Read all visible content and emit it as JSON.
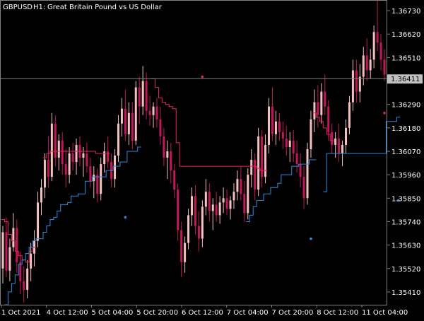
{
  "header": {
    "symbol": "GBPUSD",
    "timeframe": "H1:",
    "description": "Great Britain Pound vs US Dollar"
  },
  "colors": {
    "background": "#000000",
    "frame": "#7f7f7f",
    "text": "#ffffff",
    "candle_bull": "#f5c0c0",
    "candle_bear": "#c2185b",
    "trail_upper": "#e8245a",
    "trail_lower": "#2b8de0",
    "price_line": "#808080",
    "price_label_bg": "#c0c0c0"
  },
  "chart_data": {
    "type": "candlestick",
    "symbol": "GBPUSD",
    "timeframe": "H1",
    "title": "Great Britain Pound vs US Dollar",
    "ylim": [
      1.3535,
      1.3678
    ],
    "y_ticks": [
      "1.36730",
      "1.36620",
      "1.36510",
      "1.36290",
      "1.36180",
      "1.36070",
      "1.35960",
      "1.35850",
      "1.35740",
      "1.35630",
      "1.35520",
      "1.35410"
    ],
    "x_ticks": [
      "1 Oct 2021",
      "4 Oct 12:00",
      "5 Oct 04:00",
      "5 Oct 20:00",
      "6 Oct 12:00",
      "7 Oct 04:00",
      "7 Oct 20:00",
      "8 Oct 12:00",
      "11 Oct 04:00"
    ],
    "current_price": "1.36411",
    "candles": [
      [
        1.3552,
        1.3572,
        1.3545,
        1.3569
      ],
      [
        1.3569,
        1.3576,
        1.3548,
        1.3551
      ],
      [
        1.3551,
        1.3566,
        1.3546,
        1.3562
      ],
      [
        1.3562,
        1.3578,
        1.356,
        1.3571
      ],
      [
        1.3571,
        1.3575,
        1.355,
        1.3555
      ],
      [
        1.3555,
        1.356,
        1.354,
        1.3546
      ],
      [
        1.3546,
        1.3553,
        1.3536,
        1.3542
      ],
      [
        1.3542,
        1.3556,
        1.3538,
        1.3552
      ],
      [
        1.3552,
        1.3564,
        1.3546,
        1.3559
      ],
      [
        1.3559,
        1.357,
        1.3553,
        1.3565
      ],
      [
        1.3565,
        1.3588,
        1.3562,
        1.3583
      ],
      [
        1.3583,
        1.3594,
        1.3577,
        1.359
      ],
      [
        1.359,
        1.3606,
        1.3585,
        1.3603
      ],
      [
        1.3603,
        1.3614,
        1.359,
        1.3595
      ],
      [
        1.3595,
        1.3625,
        1.3593,
        1.362
      ],
      [
        1.362,
        1.3624,
        1.36,
        1.3604
      ],
      [
        1.3604,
        1.3615,
        1.3598,
        1.3612
      ],
      [
        1.3612,
        1.3616,
        1.3596,
        1.3601
      ],
      [
        1.3601,
        1.3608,
        1.359,
        1.3596
      ],
      [
        1.3596,
        1.3609,
        1.3592,
        1.3606
      ],
      [
        1.3606,
        1.3611,
        1.3598,
        1.3602
      ],
      [
        1.3602,
        1.3613,
        1.3596,
        1.361
      ],
      [
        1.361,
        1.3614,
        1.36,
        1.3604
      ],
      [
        1.3604,
        1.3609,
        1.3595,
        1.3606
      ],
      [
        1.3606,
        1.3611,
        1.3597,
        1.36
      ],
      [
        1.36,
        1.3604,
        1.359,
        1.3593
      ],
      [
        1.3593,
        1.36,
        1.3585,
        1.3596
      ],
      [
        1.3596,
        1.3599,
        1.3583,
        1.3587
      ],
      [
        1.3587,
        1.3604,
        1.3584,
        1.3601
      ],
      [
        1.3601,
        1.3611,
        1.3597,
        1.3607
      ],
      [
        1.3607,
        1.3614,
        1.3599,
        1.3602
      ],
      [
        1.3602,
        1.3606,
        1.359,
        1.3594
      ],
      [
        1.3594,
        1.3608,
        1.359,
        1.3605
      ],
      [
        1.3605,
        1.3624,
        1.3602,
        1.362
      ],
      [
        1.362,
        1.3632,
        1.3614,
        1.3627
      ],
      [
        1.3627,
        1.3636,
        1.3612,
        1.3615
      ],
      [
        1.3615,
        1.363,
        1.361,
        1.3625
      ],
      [
        1.3625,
        1.363,
        1.3608,
        1.3612
      ],
      [
        1.3612,
        1.364,
        1.361,
        1.3637
      ],
      [
        1.3637,
        1.3642,
        1.362,
        1.3628
      ],
      [
        1.3628,
        1.3647,
        1.3624,
        1.364
      ],
      [
        1.364,
        1.3644,
        1.3622,
        1.3626
      ],
      [
        1.3626,
        1.3633,
        1.3619,
        1.3624
      ],
      [
        1.3624,
        1.363,
        1.3618,
        1.3628
      ],
      [
        1.3628,
        1.3632,
        1.3618,
        1.3622
      ],
      [
        1.3622,
        1.3628,
        1.361,
        1.3614
      ],
      [
        1.3614,
        1.3618,
        1.36,
        1.3604
      ],
      [
        1.3604,
        1.3612,
        1.3594,
        1.3607
      ],
      [
        1.3607,
        1.3611,
        1.3592,
        1.3598
      ],
      [
        1.3598,
        1.3601,
        1.3585,
        1.3589
      ],
      [
        1.3589,
        1.3592,
        1.3565,
        1.357
      ],
      [
        1.357,
        1.3574,
        1.3548,
        1.3555
      ],
      [
        1.3555,
        1.3567,
        1.355,
        1.3564
      ],
      [
        1.3564,
        1.358,
        1.3561,
        1.3577
      ],
      [
        1.3577,
        1.359,
        1.3572,
        1.3586
      ],
      [
        1.3586,
        1.3591,
        1.3568,
        1.3572
      ],
      [
        1.3572,
        1.3579,
        1.356,
        1.3566
      ],
      [
        1.3566,
        1.3584,
        1.3562,
        1.3581
      ],
      [
        1.3581,
        1.3594,
        1.3577,
        1.3588
      ],
      [
        1.3588,
        1.3592,
        1.3574,
        1.3579
      ],
      [
        1.3579,
        1.3585,
        1.357,
        1.3582
      ],
      [
        1.3582,
        1.3588,
        1.3574,
        1.3577
      ],
      [
        1.3577,
        1.3586,
        1.3573,
        1.3583
      ],
      [
        1.3583,
        1.359,
        1.3578,
        1.3585
      ],
      [
        1.3585,
        1.3589,
        1.3577,
        1.358
      ],
      [
        1.358,
        1.3586,
        1.3575,
        1.3584
      ],
      [
        1.3584,
        1.3592,
        1.358,
        1.3588
      ],
      [
        1.3588,
        1.3598,
        1.3584,
        1.3594
      ],
      [
        1.3594,
        1.36,
        1.3584,
        1.3587
      ],
      [
        1.3587,
        1.3593,
        1.3574,
        1.3578
      ],
      [
        1.3578,
        1.3599,
        1.3575,
        1.3596
      ],
      [
        1.3596,
        1.3608,
        1.359,
        1.3603
      ],
      [
        1.3603,
        1.3606,
        1.3584,
        1.3589
      ],
      [
        1.3589,
        1.3618,
        1.3586,
        1.3614
      ],
      [
        1.3614,
        1.3617,
        1.359,
        1.3595
      ],
      [
        1.3595,
        1.3615,
        1.3592,
        1.361
      ],
      [
        1.361,
        1.3632,
        1.3606,
        1.3628
      ],
      [
        1.3628,
        1.3637,
        1.3612,
        1.3615
      ],
      [
        1.3615,
        1.3626,
        1.361,
        1.3621
      ],
      [
        1.3621,
        1.3625,
        1.3612,
        1.3616
      ],
      [
        1.3616,
        1.3621,
        1.3608,
        1.3613
      ],
      [
        1.3613,
        1.3619,
        1.3605,
        1.3609
      ],
      [
        1.3609,
        1.3616,
        1.3602,
        1.3612
      ],
      [
        1.3612,
        1.3617,
        1.3602,
        1.3606
      ],
      [
        1.3606,
        1.3612,
        1.3597,
        1.3601
      ],
      [
        1.3601,
        1.3606,
        1.359,
        1.3595
      ],
      [
        1.3595,
        1.36,
        1.358,
        1.3585
      ],
      [
        1.3585,
        1.3611,
        1.3582,
        1.3608
      ],
      [
        1.3608,
        1.3626,
        1.3604,
        1.3622
      ],
      [
        1.3622,
        1.3636,
        1.3616,
        1.363
      ],
      [
        1.363,
        1.3638,
        1.3618,
        1.3624
      ],
      [
        1.3624,
        1.3639,
        1.362,
        1.3635
      ],
      [
        1.3635,
        1.3643,
        1.3624,
        1.3628
      ],
      [
        1.3628,
        1.3631,
        1.3612,
        1.3616
      ],
      [
        1.3616,
        1.362,
        1.3606,
        1.361
      ],
      [
        1.361,
        1.3616,
        1.3604,
        1.3613
      ],
      [
        1.3613,
        1.362,
        1.3602,
        1.3606
      ],
      [
        1.3606,
        1.3612,
        1.36,
        1.361
      ],
      [
        1.361,
        1.3622,
        1.3606,
        1.3618
      ],
      [
        1.3618,
        1.3633,
        1.3615,
        1.363
      ],
      [
        1.363,
        1.365,
        1.3626,
        1.3645
      ],
      [
        1.3645,
        1.365,
        1.363,
        1.3635
      ],
      [
        1.3635,
        1.3648,
        1.363,
        1.3642
      ],
      [
        1.3642,
        1.3656,
        1.3638,
        1.3652
      ],
      [
        1.3652,
        1.366,
        1.364,
        1.3645
      ],
      [
        1.3645,
        1.3655,
        1.3641,
        1.365
      ],
      [
        1.365,
        1.3666,
        1.3646,
        1.3663
      ],
      [
        1.3663,
        1.3678,
        1.3654,
        1.3658
      ],
      [
        1.3658,
        1.3662,
        1.3645,
        1.365
      ],
      [
        1.365,
        1.3655,
        1.364,
        1.3643
      ]
    ],
    "upper_trail": [
      {
        "from": 0,
        "to": 9,
        "levels": [
          1.3575,
          1.3574,
          1.3568,
          1.3565,
          1.356,
          1.3558,
          1.3556,
          1.3555,
          1.356,
          1.3562
        ]
      },
      {
        "from": 12,
        "to": 30,
        "levels": [
          1.3604,
          1.3606,
          1.3607,
          1.3607,
          1.3607,
          1.3607,
          1.3607,
          1.3607,
          1.3607,
          1.3607,
          1.3607,
          1.3607,
          1.3607,
          1.3607,
          1.3607,
          1.3606,
          1.3606,
          1.3606,
          1.3606
        ]
      },
      {
        "from": 43,
        "to": 75,
        "levels": [
          1.3641,
          1.3637,
          1.3632,
          1.363,
          1.3629,
          1.3628,
          1.3627,
          1.3611,
          1.36,
          1.36,
          1.36,
          1.36,
          1.36,
          1.36,
          1.36,
          1.36,
          1.36,
          1.36,
          1.36,
          1.36,
          1.36,
          1.36,
          1.36,
          1.36,
          1.36,
          1.36,
          1.36,
          1.36,
          1.36,
          1.36,
          1.3599,
          1.3598,
          1.3598
        ]
      },
      {
        "from": 89,
        "to": 94,
        "levels": [
          1.3625,
          1.3623,
          1.3621,
          1.3618,
          1.3615,
          1.3612
        ]
      }
    ],
    "lower_trail": [
      {
        "from": 1,
        "to": 39,
        "levels": [
          1.3535,
          1.3541,
          1.3545,
          1.3549,
          1.3554,
          1.3556,
          1.3559,
          1.3562,
          1.3565,
          1.3566,
          1.3566,
          1.3569,
          1.3572,
          1.3575,
          1.3576,
          1.3579,
          1.3582,
          1.3582,
          1.3583,
          1.3586,
          1.3586,
          1.3587,
          1.3587,
          1.3593,
          1.3593,
          1.3595,
          1.3595,
          1.3595,
          1.3595,
          1.3598,
          1.3598,
          1.36,
          1.36,
          1.3602,
          1.3602,
          1.3607,
          1.3607,
          1.3607,
          1.3609
        ]
      },
      {
        "from": 70,
        "to": 89,
        "levels": [
          1.3574,
          1.3577,
          1.3581,
          1.3584,
          1.3584,
          1.3587,
          1.3587,
          1.359,
          1.359,
          1.3592,
          1.3596,
          1.3596,
          1.3596,
          1.36,
          1.36,
          1.3601,
          1.3601,
          1.3601,
          1.3603,
          1.3603
        ]
      },
      {
        "from": 92,
        "to": 113,
        "levels": [
          1.3588,
          1.3606,
          1.3606,
          1.3606,
          1.3606,
          1.3606,
          1.3606,
          1.3606,
          1.3606,
          1.3606,
          1.3606,
          1.3606,
          1.3606,
          1.3606,
          1.3606,
          1.3606,
          1.3606,
          1.3606,
          1.3621,
          1.3621,
          1.3621,
          1.3623
        ]
      }
    ],
    "signal_dots": [
      {
        "index": 35,
        "level": 1.3576,
        "side": "lower"
      },
      {
        "index": 57,
        "level": 1.3642,
        "side": "upper"
      },
      {
        "index": 88,
        "level": 1.3566,
        "side": "lower"
      },
      {
        "index": 109,
        "level": 1.3625,
        "side": "upper"
      },
      {
        "index": 113,
        "level": 1.3584,
        "side": "lower"
      }
    ]
  }
}
